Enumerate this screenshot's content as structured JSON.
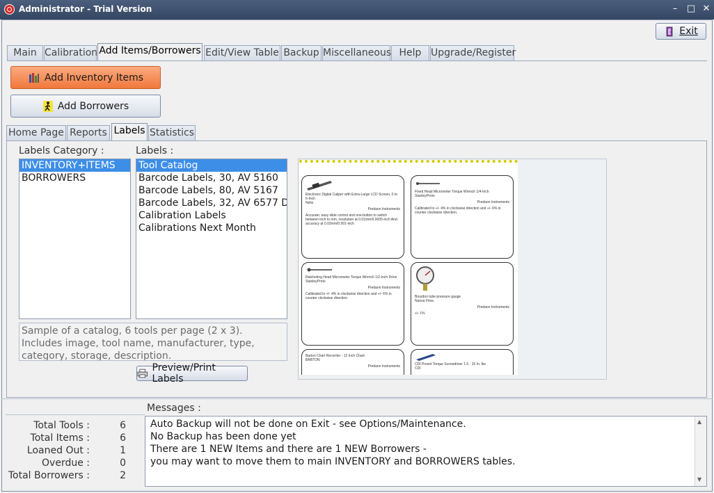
{
  "window": {
    "title": "Administrator - Trial Version"
  },
  "toolbar": {
    "exit_label": "Exit"
  },
  "main_tabs": [
    "Main",
    "Calibration",
    "Add Items/Borrowers",
    "Edit/View Table",
    "Backup",
    "Miscellaneous",
    "Help",
    "Upgrade/Register"
  ],
  "actions": {
    "add_inventory": "Add Inventory Items",
    "add_borrowers": "Add Borrowers"
  },
  "sub_tabs": [
    "Home Page",
    "Reports",
    "Labels",
    "Statistics"
  ],
  "labels_panel": {
    "category_header": "Labels Category :",
    "categories": [
      "INVENTORY+ITEMS",
      "BORROWERS"
    ],
    "labels_header": "Labels :",
    "labels": [
      "Tool Catalog",
      "Barcode Labels, 30, AV 5160",
      "Barcode Labels, 80, AV 5167",
      "Barcode Labels, 32, AV 6577 D",
      "Calibration Labels",
      "Calibrations Next Month"
    ],
    "description": "Sample of a catalog, 6 tools per page (2 x 3). Includes image, tool name, manufacturer, type, category, storage, description.",
    "preview_button": "Preview/Print Labels"
  },
  "preview_cards": [
    {
      "name": "Electronic Digital Caliper with Extra-Large LCD Screen, 0 to 6-Inch",
      "type": "Nelio",
      "mfg": "Predaon Instruments",
      "desc": "Accurate; easy slide control and one-button to switch between inch to mm, resolution at 0.01mm/0.0005-inch And accuracy at 0.02mm/0.001-inch"
    },
    {
      "name": "Fixed Head Micrometer Torque Wrench 1/4-Inch",
      "type": "StanleyProto",
      "mfg": "Predaon Instruments",
      "desc": "Calibrated to +/- 4% in clockwise direction and +/- 6% in counter clockwise direction."
    },
    {
      "name": "Ratcheting Head Micrometer Torque Wrench 1/2-Inch Drive",
      "type": "StanleyProto",
      "mfg": "Predaon Instruments",
      "desc": "Calibrated to +/- 4% in clockwise direction and +/- 6% in counter clockwise direction."
    },
    {
      "name": "Bourdon tube pressure gauge",
      "type": "Nuova Fima",
      "mfg": "Predaon Instruments",
      "desc": "+/- 1%"
    },
    {
      "name": "Barton Chart Recorder - 12 Inch Chart",
      "type": "BARTON",
      "mfg": "Predaon Instruments",
      "desc": ""
    },
    {
      "name": "CDI Preset Torque Screwdriver 1.5 - 15 In.  lbs",
      "type": "CDI",
      "mfg": "",
      "desc": ""
    }
  ],
  "messages": {
    "header": "Messages :",
    "lines": [
      "Auto Backup will not be done on Exit - see Options/Maintenance.",
      "No Backup has been done yet",
      "There are 1 NEW Items and there are 1 NEW Borrowers -",
      "you may want to move them to main INVENTORY and BORROWERS tables."
    ]
  },
  "stats": [
    {
      "label": "Total Tools :",
      "value": "6"
    },
    {
      "label": "Total Items :",
      "value": "6"
    },
    {
      "label": "Loaned Out :",
      "value": "1"
    },
    {
      "label": "Overdue :",
      "value": "0"
    },
    {
      "label": "Total Borrowers :",
      "value": "2"
    }
  ],
  "colors": {
    "accent_orange": "#f58a52",
    "selection": "#3d8ee6",
    "titlebar": "#3d5170"
  }
}
